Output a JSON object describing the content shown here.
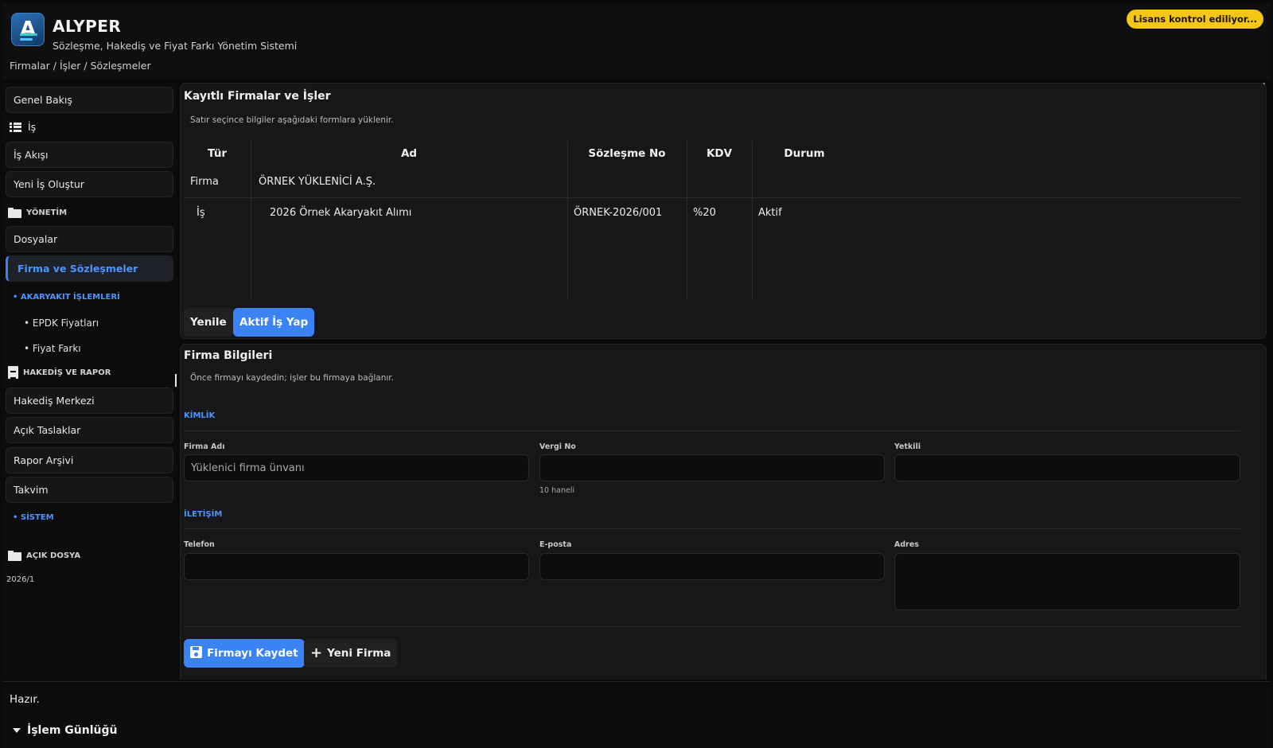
{
  "header": {
    "title": "ALYPER",
    "subtitle": "Sözleşme, Hakediş ve Fiyat Farkı Yönetim Sistemi",
    "breadcrumb": "Firmalar / İşler / Sözleşmeler",
    "license_badge": "Lisans kontrol ediliyor..."
  },
  "sidebar": {
    "overview": "Genel Bakış",
    "is_label": "İş",
    "workflow": "İş Akışı",
    "new_job": "Yeni İş Oluştur",
    "management": "YÖNETİM",
    "files": "Dosyalar",
    "firms_contracts": "Firma ve Sözleşmeler",
    "fuel_ops": "• AKARYAKIT İŞLEMLERİ",
    "epdk": "• EPDK Fiyatları",
    "price_diff": "• Fiyat Farkı",
    "progress_report": "HAKEDİŞ VE RAPOR",
    "progress_center": "Hakediş Merkezi",
    "open_drafts": "Açık Taslaklar",
    "report_archive": "Rapor Arşivi",
    "calendar": "Takvim",
    "system": "• SİSTEM",
    "open_file": "AÇIK DOSYA",
    "open_file_value": "2026/1"
  },
  "registry": {
    "title": "Kayıtlı Firmalar ve İşler",
    "hint": "Satır seçince bilgiler aşağıdaki formlara yüklenir.",
    "columns": [
      "Tür",
      "Ad",
      "Sözleşme No",
      "KDV",
      "Durum"
    ],
    "rows": [
      {
        "type": "Firma",
        "name": "ÖRNEK YÜKLENİCİ A.Ş.",
        "contract_no": "",
        "vat": "",
        "status": ""
      },
      {
        "type": "İş",
        "name": "2026 Örnek Akaryakıt Alımı",
        "contract_no": "ÖRNEK-2026/001",
        "vat": "%20",
        "status": "Aktif"
      }
    ],
    "refresh_label": "Yenile",
    "set_active_label": "Aktif İş Yap"
  },
  "firm_form": {
    "title": "Firma Bilgileri",
    "hint": "Önce firmayı kaydedin; işler bu firmaya bağlanır.",
    "identity_label": "KİMLİK",
    "firm_name_label": "Firma Adı",
    "firm_name_placeholder": "Yüklenici firma ünvanı",
    "tax_no_label": "Vergi No",
    "tax_no_help": "10 haneli",
    "authorized_label": "Yetkili",
    "contact_label": "İLETİŞİM",
    "phone_label": "Telefon",
    "email_label": "E-posta",
    "address_label": "Adres",
    "save_label": "Firmayı Kaydet",
    "new_label": "Yeni Firma"
  },
  "status": {
    "text": "Hazır.",
    "log_label": "İşlem Günlüğü"
  },
  "colors": {
    "accent": "#3b82f6",
    "license_badge": "#f5c518"
  }
}
